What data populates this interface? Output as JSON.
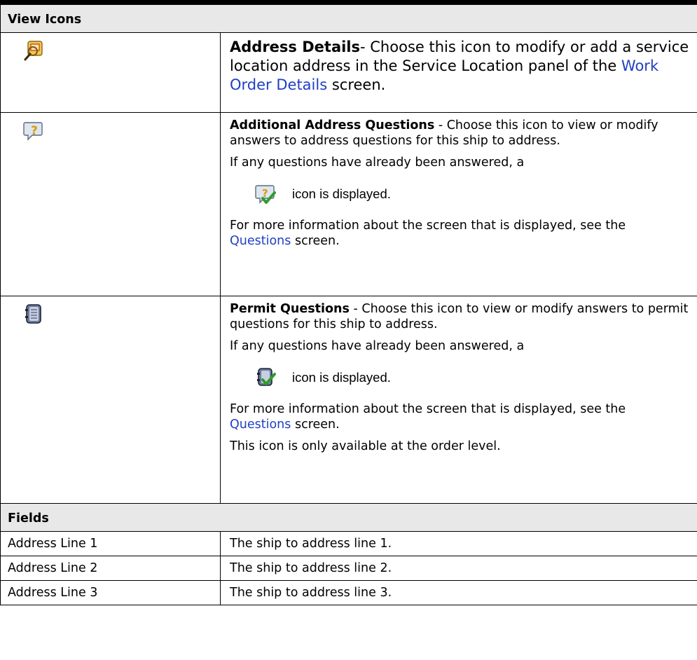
{
  "view_icons_header": "View Icons",
  "rows": {
    "address_details": {
      "icon": "address-details-icon",
      "title": "Address Details",
      "text_a": "- Choose this icon to modify or add a service location address in the Service Location panel of the ",
      "link": "Work Order Details",
      "text_b": " screen."
    },
    "additional_questions": {
      "icon": "additional-address-questions-icon",
      "title": "Additional Address Questions",
      "text_a": " - Choose this icon to view or modify answers to address questions for this ship to address.",
      "answered_text": "If any questions have already been answered, a",
      "answered_icon": "answered-address-questions-icon",
      "icon_caption": "icon is displayed.",
      "more_a": "For more information about the screen that is displayed, see the ",
      "more_link": "Questions",
      "more_b": " screen."
    },
    "permit_questions": {
      "icon": "permit-questions-icon",
      "title": "Permit Questions",
      "text_a": " - Choose this icon to view or modify answers to permit questions for this ship to address.",
      "answered_text": "If any questions have already been answered, a",
      "answered_icon": "answered-permit-questions-icon",
      "icon_caption": "icon is displayed.",
      "more_a": "For more information about the screen that is displayed, see the ",
      "more_link": "Questions",
      "more_b": " screen.",
      "note": "This icon is only available at the order level."
    }
  },
  "fields_header": "Fields",
  "fields": [
    {
      "name": "Address Line 1",
      "desc": "The ship to address line 1."
    },
    {
      "name": "Address Line 2",
      "desc": "The ship to address line 2."
    },
    {
      "name": "Address Line 3",
      "desc": "The ship to address line 3."
    }
  ],
  "colors": {
    "link": "#1f3fc4",
    "header_bg": "#e8e8e8",
    "border": "#000000"
  }
}
